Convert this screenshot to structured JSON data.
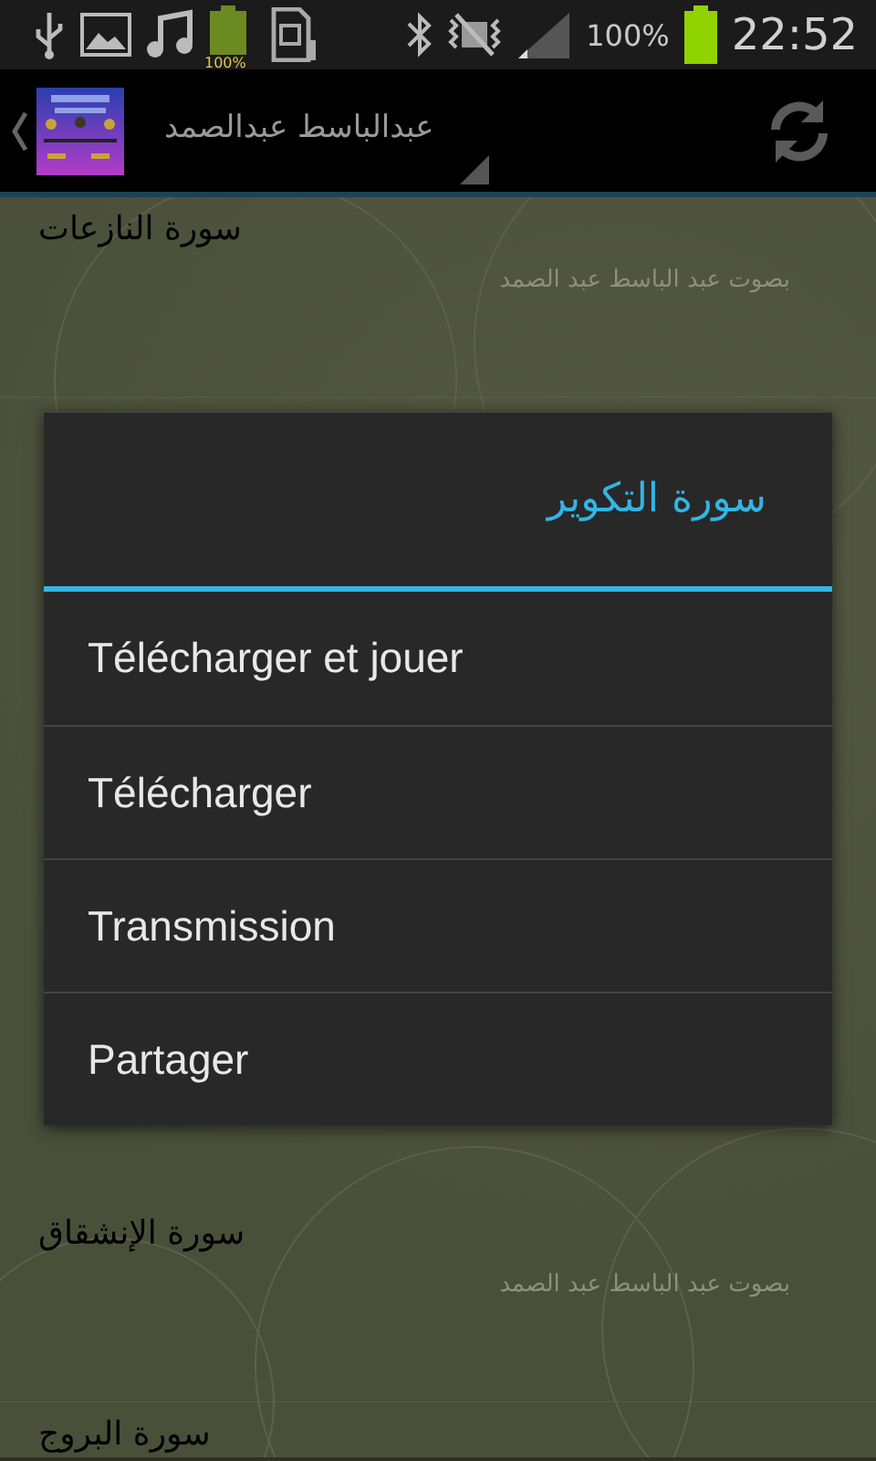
{
  "status_bar": {
    "battery_icon_text": "100%",
    "battery_percent": "100%",
    "time": "22:52"
  },
  "action_bar": {
    "title": "عبدالباسط عبدالصمد"
  },
  "list": {
    "rows": [
      {
        "title": "سورة النازعات",
        "subtitle": "بصوت عبد الباسط عبد الصمد"
      },
      {
        "title": "سورة الإنشقاق",
        "subtitle": "بصوت عبد الباسط عبد الصمد"
      },
      {
        "title": "سورة البروج"
      }
    ]
  },
  "dialog": {
    "title": "سورة التكوير",
    "items": [
      "Télécharger et jouer",
      "Télécharger",
      "Transmission",
      "Partager"
    ]
  }
}
